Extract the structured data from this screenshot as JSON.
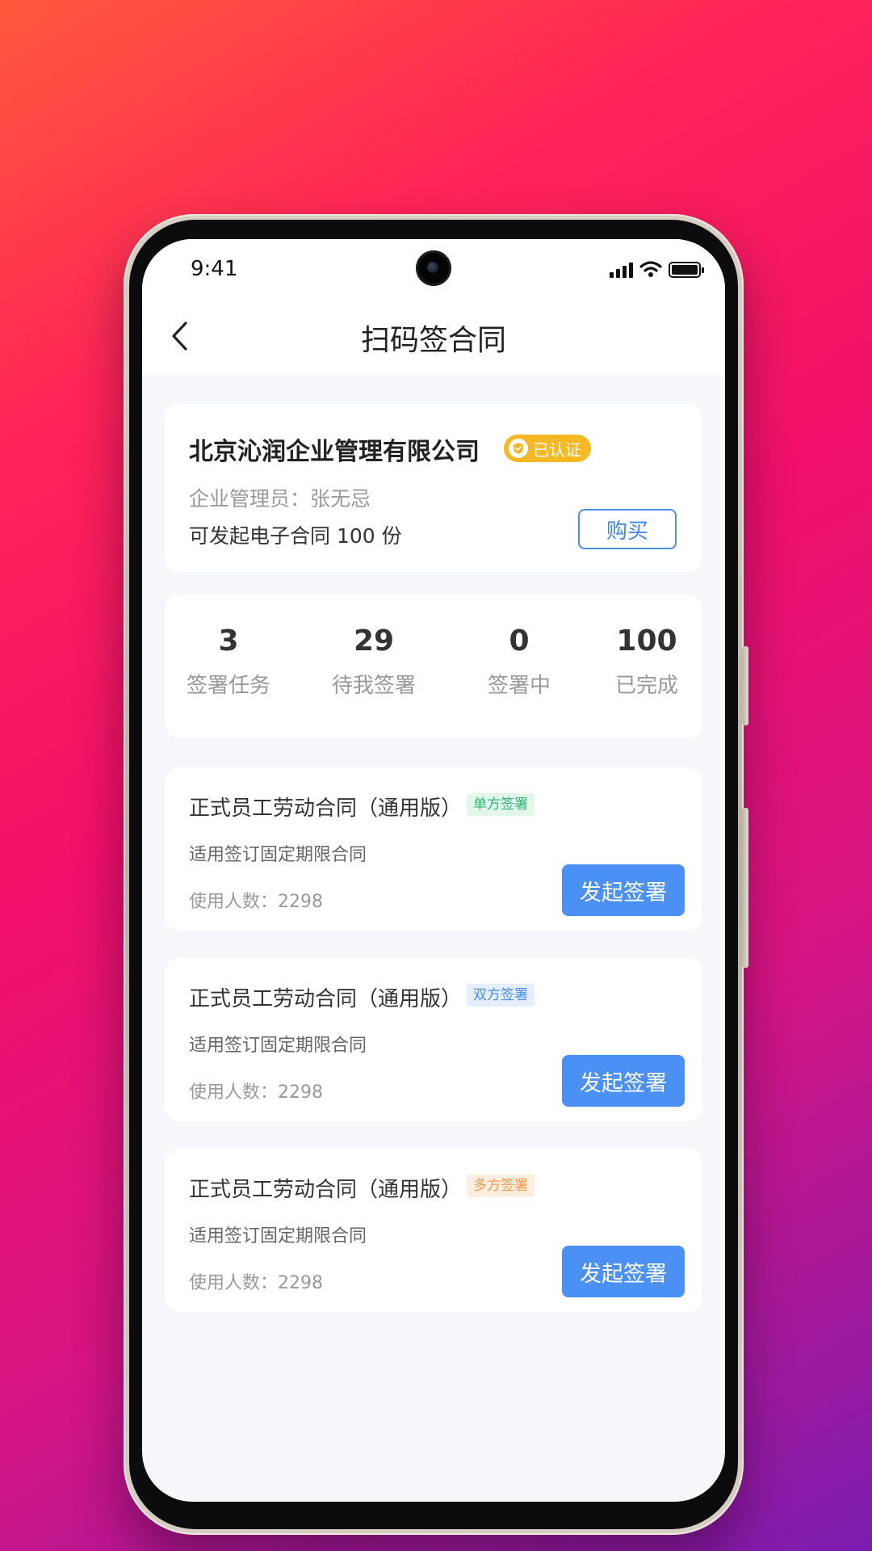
{
  "status_bar": {
    "time": "9:41"
  },
  "nav": {
    "title": "扫码签合同"
  },
  "company": {
    "name": "北京沁润企业管理有限公司",
    "verified_label": "已认证",
    "admin_label": "企业管理员：张无忌",
    "contract_quota": "可发起电子合同 100 份",
    "buy_label": "购买"
  },
  "stats": [
    {
      "value": "3",
      "label": "签署任务"
    },
    {
      "value": "29",
      "label": "待我签署"
    },
    {
      "value": "0",
      "label": "签署中"
    },
    {
      "value": "100",
      "label": "已完成"
    }
  ],
  "templates": [
    {
      "title": "正式员工劳动合同（通用版）",
      "tag": "单方签署",
      "tag_color": "#2bb673",
      "tag_bg": "#e3f6ec",
      "desc": "适用签订固定期限合同",
      "users": "使用人数：2298",
      "button": "发起签署"
    },
    {
      "title": "正式员工劳动合同（通用版）",
      "tag": "双方签署",
      "tag_color": "#4a8ff0",
      "tag_bg": "#e4eefc",
      "desc": "适用签订固定期限合同",
      "users": "使用人数：2298",
      "button": "发起签署"
    },
    {
      "title": "正式员工劳动合同（通用版）",
      "tag": "多方签署",
      "tag_color": "#f59a45",
      "tag_bg": "#fdeee0",
      "desc": "适用签订固定期限合同",
      "users": "使用人数：2298",
      "button": "发起签署"
    }
  ],
  "colors": {
    "accent": "#4a90f5",
    "verified": "#f7b923",
    "page_bg": "#f6f7fb"
  }
}
